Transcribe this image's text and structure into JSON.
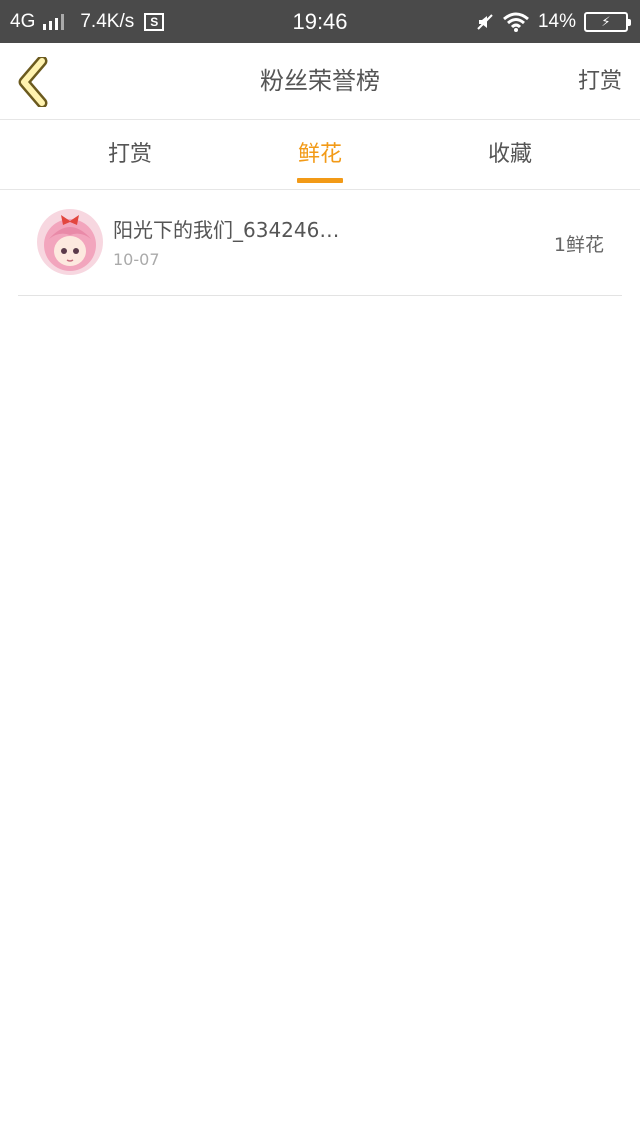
{
  "status_bar": {
    "network": "4G",
    "speed": "7.4K/s",
    "s_badge": "S",
    "time": "19:46",
    "battery": "14%"
  },
  "header": {
    "title": "粉丝荣誉榜",
    "action_label": "打赏",
    "back_icon": "chevron-left-icon"
  },
  "tabs": [
    {
      "label": "打赏",
      "active": false
    },
    {
      "label": "鲜花",
      "active": true
    },
    {
      "label": "收藏",
      "active": false
    }
  ],
  "list": [
    {
      "name": "阳光下的我们_634246…",
      "date": "10-07",
      "value": "1鲜花"
    }
  ],
  "colors": {
    "accent": "#f29a17",
    "status_bar": "#4a4a4a",
    "back_icon_fill": "#fff3b0",
    "back_icon_stroke": "#6b5a1e"
  }
}
